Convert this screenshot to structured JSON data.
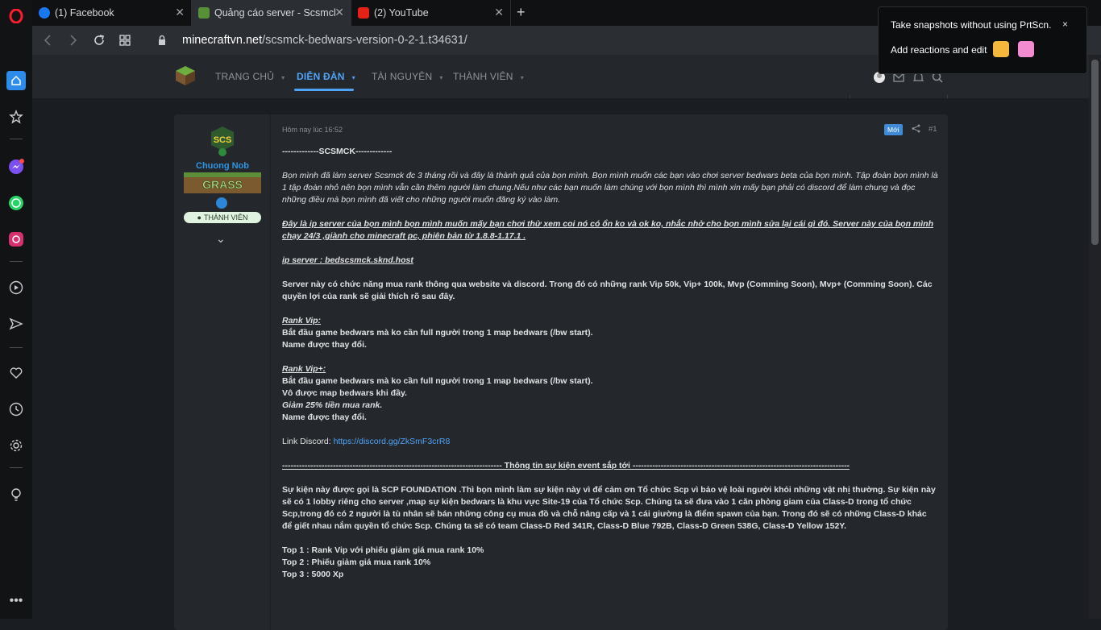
{
  "browser": {
    "tabs": [
      {
        "label": "(1) Facebook",
        "favicon_color": "#1877f2"
      },
      {
        "label": "Quảng cáo server - Scsmck",
        "favicon_color": "#5a8f3a"
      },
      {
        "label": "(2) YouTube",
        "favicon_color": "#e62117"
      }
    ],
    "new_tab": "+",
    "url_domain": "minecraftvn.net",
    "url_path": "/scsmck-bedwars-version-0-2-1.t34631/"
  },
  "snapshot_popup": {
    "line1": "Take snapshots without using PrtScn.",
    "line2": "Add reactions and edit",
    "close": "×"
  },
  "site_nav": {
    "items": [
      "TRANG CHỦ",
      "DIỄN ĐÀN",
      "TÀI NGUYÊN",
      "THÀNH VIÊN"
    ],
    "active_index": 1,
    "accent": "#4fa3f7"
  },
  "user": {
    "name": "Chuong Nob",
    "role": "THÀNH VIÊN",
    "banner": "GRASS",
    "avatar_text": "SCS"
  },
  "post": {
    "timestamp": "Hôm nay lúc 16:52",
    "new_badge": "Mới",
    "number": "#1",
    "header": "-------------SCSMCK-------------",
    "intro": "Bọn mình đã làm server Scsmck đc 3 tháng rồi và đây là thành quả của bọn mình. Bọn mình muốn các bạn vào chơi server bedwars beta của bọn mình. Tập đoàn bọn mình là 1 tập đoàn nhỏ nên bọn mình vẫn cần thêm người làm chung.Nếu như các bạn muốn làm chúng với bọn mình thì mình xin mấy bạn phải có discord để làm chung và đọc những điều mà bọn mình đã viết cho những người muốn đăng ký vào làm.",
    "ip_notice": "Đây là ip server của bọn mình bọn mình muốn mấy bạn chơi thử xem coi nó có ổn ko và ok ko, nhắc nhở cho bọn mình sửa lại cái gì đó. Server này của bọn mình chạy 24/3 ,giành cho minecraft pc, phiên bản từ 1.8.8-1.17.1 .",
    "ip": "ip server : bedscsmck.sknd.host",
    "rank_intro": "Server này có chức năng mua rank thông qua website và discord. Trong đó có những rank Vip 50k, Vip+ 100k, Mvp (Comming Soon), Mvp+ (Comming Soon). Các quyền lợi của rank sẽ giải thích rõ sau đây.",
    "rank_vip_title": "Rank Vip:",
    "rank_vip_1": "Bắt đầu game bedwars mà ko cần full người trong 1 map bedwars (/bw start).",
    "rank_vip_2": "Name được thay đổi.",
    "rank_vipp_title": "Rank Vip+:",
    "rank_vipp_1": "Bắt đầu game bedwars mà ko cần full người trong 1 map bedwars (/bw start).",
    "rank_vipp_2": "Vô được map bedwars khi đầy.",
    "rank_vipp_3": "Giảm 25% tiền mua rank.",
    "rank_vipp_4": "Name được thay đổi.",
    "discord_label": "Link Discord: ",
    "discord_url": "https://discord.gg/ZkSmF3crR8",
    "event_divider": "------------------------------------------------------------------------------ Thông tin sự kiện event sắp tới -----------------------------------------------------------------------------",
    "event_text": "Sự kiện này được gọi là SCP FOUNDATION .Thì bọn mình làm sự kiện này vì để cảm ơn Tổ chức Scp vì bảo vệ loài người khỏi những vật nhị thường. Sự kiện này sẽ có 1 lobby riêng cho server ,map sự kiện bedwars là khu vực Site-19 của Tổ chức Scp. Chúng ta sẽ đưa vào 1 căn phòng giam của Class-D trong tổ chức Scp,trong đó có 2 người là tù nhân sẽ bán những công cụ mua đồ và chỗ nâng cấp và 1 cái giường là điểm spawn của bạn. Trong đó sẽ có những Class-D khác để giết nhau nắm quyền tổ chức Scp. Chúng ta sẽ có team Class-D Red 341R, Class-D Blue 792B, Class-D Green 538G, Class-D Yellow 152Y.",
    "top1": "Top 1 : Rank Vip với phiếu giảm giá mua rank 10%",
    "top2": "Top 2 : Phiếu giảm giá mua rank 10%",
    "top3": "Top 3 : 5000 Xp"
  }
}
